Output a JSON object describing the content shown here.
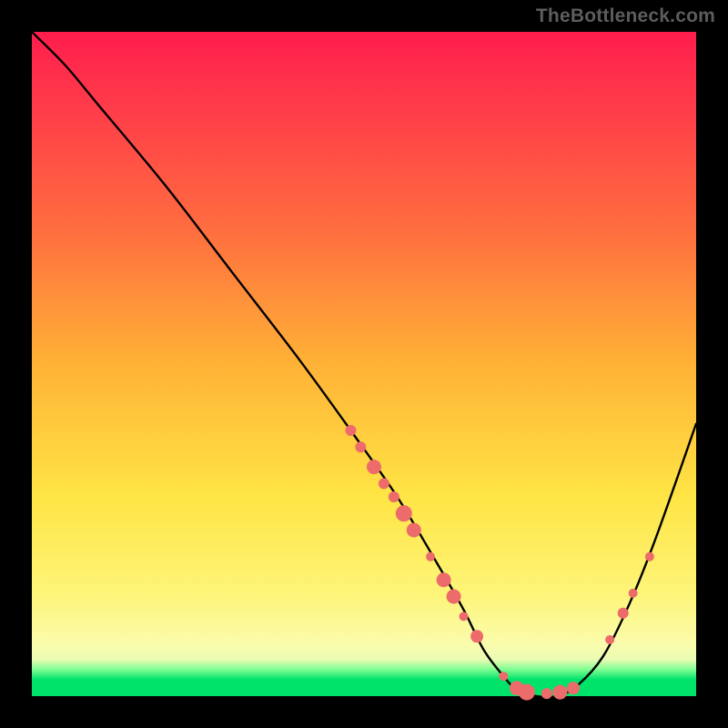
{
  "watermark": "TheBottleneck.com",
  "colors": {
    "dot": "#ed6b6b",
    "curve": "#000000",
    "bg_black": "#000000"
  },
  "chart_data": {
    "type": "line",
    "title": "",
    "xlabel": "",
    "ylabel": "",
    "xlim": [
      0,
      100
    ],
    "ylim": [
      0,
      100
    ],
    "series": [
      {
        "name": "curve",
        "x": [
          0,
          5,
          10,
          20,
          30,
          40,
          48,
          55,
          61,
          65,
          68,
          71,
          73,
          76,
          79,
          82,
          86,
          90,
          94,
          100
        ],
        "y": [
          100,
          95,
          89,
          77,
          64,
          51,
          40,
          30,
          20,
          13,
          7,
          3,
          1,
          0,
          0,
          1.5,
          6,
          14,
          24,
          41
        ]
      }
    ],
    "markers": [
      {
        "x": 48.0,
        "y": 40.0,
        "r": 6
      },
      {
        "x": 49.5,
        "y": 37.5,
        "r": 6
      },
      {
        "x": 51.5,
        "y": 34.5,
        "r": 8
      },
      {
        "x": 53.0,
        "y": 32.0,
        "r": 6
      },
      {
        "x": 54.5,
        "y": 30.0,
        "r": 6
      },
      {
        "x": 56.0,
        "y": 27.5,
        "r": 9
      },
      {
        "x": 57.5,
        "y": 25.0,
        "r": 8
      },
      {
        "x": 60.0,
        "y": 21.0,
        "r": 5
      },
      {
        "x": 62.0,
        "y": 17.5,
        "r": 8
      },
      {
        "x": 63.5,
        "y": 15.0,
        "r": 8
      },
      {
        "x": 65.0,
        "y": 12.0,
        "r": 5
      },
      {
        "x": 67.0,
        "y": 9.0,
        "r": 7
      },
      {
        "x": 71.0,
        "y": 3.0,
        "r": 5
      },
      {
        "x": 73.0,
        "y": 1.2,
        "r": 8
      },
      {
        "x": 74.5,
        "y": 0.6,
        "r": 9
      },
      {
        "x": 77.5,
        "y": 0.4,
        "r": 6
      },
      {
        "x": 79.5,
        "y": 0.6,
        "r": 8
      },
      {
        "x": 81.5,
        "y": 1.2,
        "r": 7
      },
      {
        "x": 87.0,
        "y": 8.5,
        "r": 5
      },
      {
        "x": 89.0,
        "y": 12.5,
        "r": 6
      },
      {
        "x": 90.5,
        "y": 15.5,
        "r": 5
      },
      {
        "x": 93.0,
        "y": 21.0,
        "r": 5
      }
    ]
  }
}
